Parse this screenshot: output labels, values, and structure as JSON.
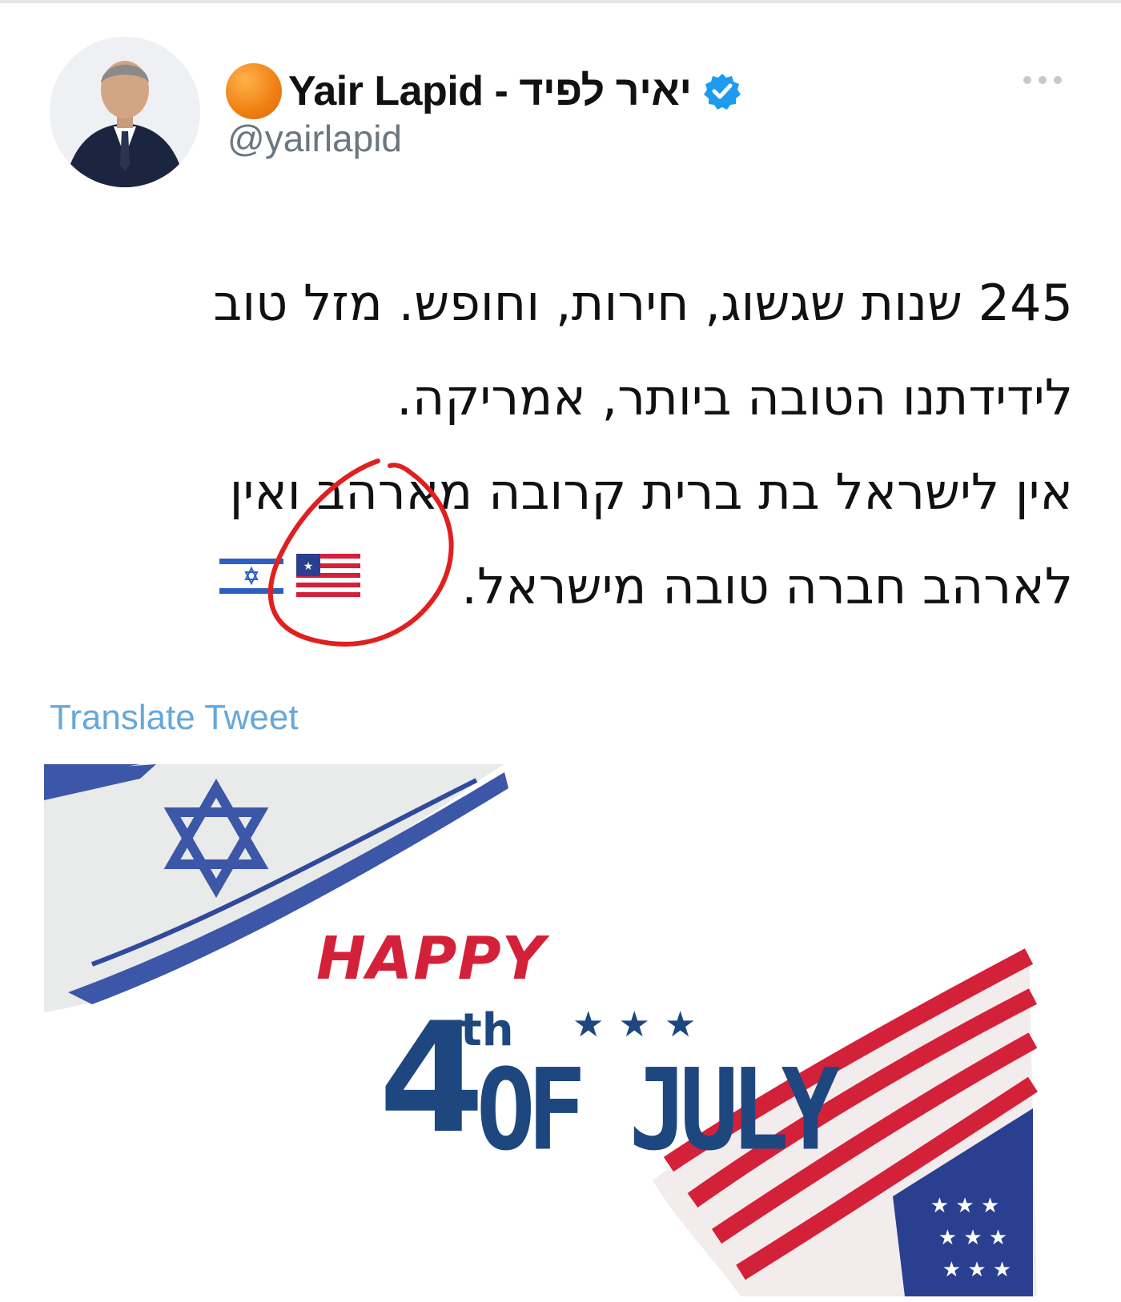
{
  "author": {
    "display_name": "Yair Lapid - יאיר לפיד",
    "handle": "@yairlapid",
    "verified": true
  },
  "tweet": {
    "lines": [
      "245 שנות שגשוג, חירות, וחופש. מזל טוב",
      "לידידתנו הטובה ביותר, אמריקה.",
      "אין לישראל בת ברית קרובה מארהב ואין",
      "לארהב חברה טובה מישראל."
    ],
    "emojis": [
      "us-flag-icon",
      "israel-flag-icon"
    ]
  },
  "translate_label": "Translate Tweet",
  "media": {
    "happy": "HAPPY",
    "number": "4",
    "suffix": "th",
    "stars": "★★★",
    "of_july": "OF JULY"
  },
  "colors": {
    "accent_blue": "#1d9bf0",
    "link_blue": "#66a8da",
    "annotation_red": "#e02020",
    "flag_blue": "#1e4780",
    "flag_red": "#d4213a"
  }
}
